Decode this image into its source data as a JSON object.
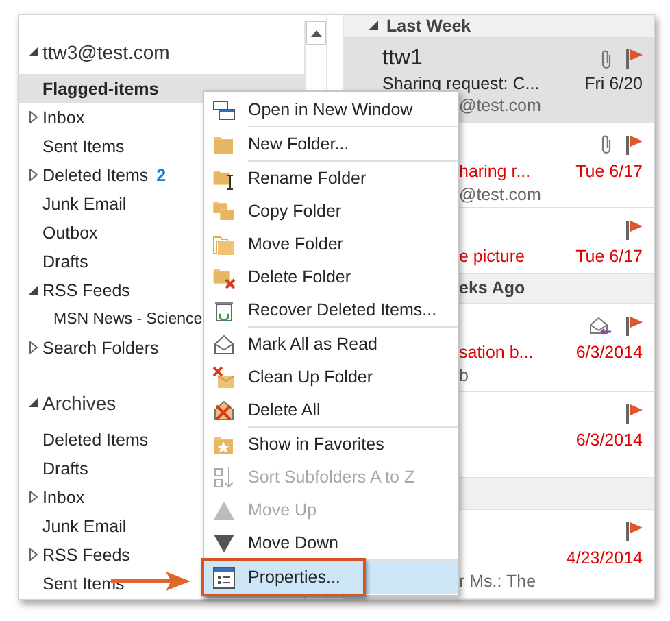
{
  "folder_pane": {
    "account": {
      "label": "ttw3@test.com",
      "expanded": true
    },
    "folders": [
      {
        "label": "Flagged-items",
        "selected": true
      },
      {
        "label": "Inbox",
        "selected": false,
        "has_children": true
      },
      {
        "label": "Sent Items",
        "selected": false
      },
      {
        "label": "Deleted Items",
        "selected": false,
        "has_children": true,
        "count": "2"
      },
      {
        "label": "Junk Email",
        "selected": false
      },
      {
        "label": "Outbox",
        "selected": false
      },
      {
        "label": "Drafts",
        "selected": false
      },
      {
        "label": "RSS Feeds",
        "selected": false,
        "expanded": true,
        "children": [
          {
            "label": "MSN News - Science",
            "selected": false
          }
        ]
      },
      {
        "label": "Search Folders",
        "selected": false,
        "has_children": true
      }
    ],
    "archives": {
      "label": "Archives",
      "expanded": true
    },
    "archive_folders": [
      {
        "label": "Deleted Items",
        "selected": false
      },
      {
        "label": "Drafts",
        "selected": false
      },
      {
        "label": "Inbox",
        "selected": false,
        "has_children": true
      },
      {
        "label": "Junk Email",
        "selected": false
      },
      {
        "label": "RSS Feeds",
        "selected": false,
        "has_children": true
      },
      {
        "label": "Sent Items",
        "selected": false
      }
    ]
  },
  "message_list": [
    {
      "kind": "group",
      "label": "Last Week"
    },
    {
      "kind": "message",
      "sender": "ttw1",
      "subject": "Sharing request: C...",
      "preview": "@test.com",
      "date": "Fri 6/20",
      "attachment": true,
      "flagged": true,
      "replied": false,
      "overdue": false,
      "selected": true
    },
    {
      "kind": "message",
      "subject": "haring r...",
      "preview": "@test.com",
      "date": "Tue 6/17",
      "attachment": true,
      "flagged": true,
      "replied": false,
      "overdue": true,
      "selected": false
    },
    {
      "kind": "message",
      "subject": "e picture",
      "date": "Tue 6/17",
      "attachment": false,
      "flagged": true,
      "replied": false,
      "overdue": true,
      "selected": false
    },
    {
      "kind": "group",
      "label": "eks Ago"
    },
    {
      "kind": "message",
      "subject": "sation b...",
      "preview": "b",
      "date": "6/3/2014",
      "attachment": false,
      "flagged": true,
      "replied": true,
      "overdue": true,
      "selected": false
    },
    {
      "kind": "message",
      "date": "6/3/2014",
      "attachment": false,
      "flagged": true,
      "replied": false,
      "overdue": true,
      "selected": false
    },
    {
      "kind": "group"
    },
    {
      "kind": "message",
      "preview": "r Ms.:  The",
      "date": "4/23/2014",
      "attachment": false,
      "flagged": true,
      "replied": false,
      "overdue": true,
      "selected": false
    }
  ],
  "context_menu": [
    {
      "label": "Open in New Window",
      "disabled": false,
      "selected": false
    },
    {
      "label": "New Folder...",
      "disabled": false,
      "selected": false,
      "separator_before": true
    },
    {
      "label": "Rename Folder",
      "disabled": false,
      "selected": false,
      "separator_before": true
    },
    {
      "label": "Copy Folder",
      "disabled": false,
      "selected": false
    },
    {
      "label": "Move Folder",
      "disabled": false,
      "selected": false
    },
    {
      "label": "Delete Folder",
      "disabled": false,
      "selected": false
    },
    {
      "label": "Recover Deleted Items...",
      "disabled": false,
      "selected": false
    },
    {
      "label": "Mark All as Read",
      "disabled": false,
      "selected": false,
      "separator_before": true
    },
    {
      "label": "Clean Up Folder",
      "disabled": false,
      "selected": false
    },
    {
      "label": "Delete All",
      "disabled": false,
      "selected": false
    },
    {
      "label": "Show in Favorites",
      "disabled": false,
      "selected": false,
      "separator_before": true
    },
    {
      "label": "Sort Subfolders A to Z",
      "disabled": true,
      "selected": false
    },
    {
      "label": "Move Up",
      "disabled": true,
      "selected": false
    },
    {
      "label": "Move Down",
      "disabled": false,
      "selected": false
    },
    {
      "label": "Properties...",
      "disabled": false,
      "selected": true,
      "separator_before": true
    }
  ]
}
